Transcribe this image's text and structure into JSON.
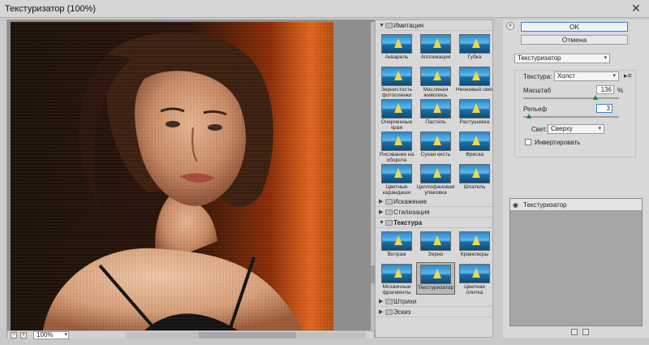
{
  "window": {
    "title": "Текстуризатор (100%)"
  },
  "preview": {
    "zoom": "100%",
    "zoom_out": "−",
    "zoom_in": "+"
  },
  "gallery": {
    "groups": [
      {
        "name": "Имитация",
        "expanded": true,
        "bold": false,
        "items": [
          "Акварель",
          "Аппликация",
          "Губка",
          "Зернистость фотопленки",
          "Масляная живопись",
          "Неоновый свет",
          "Очерченные края",
          "Пастель",
          "Растушевка",
          "Рисование на обороте",
          "Сухая кисть",
          "Фреска",
          "Цветные карандаши",
          "Целлофановая упаковка",
          "Шпатель"
        ]
      },
      {
        "name": "Искажение",
        "expanded": false
      },
      {
        "name": "Стилизация",
        "expanded": false
      },
      {
        "name": "Текстура",
        "expanded": true,
        "bold": true,
        "items": [
          "Витраж",
          "Зерно",
          "Кракелюры",
          "Мозаичные фрагменты",
          "Текстуризатор",
          "Цветная плитка"
        ],
        "selected": "Текстуризатор"
      },
      {
        "name": "Штрихи",
        "expanded": false
      },
      {
        "name": "Эскиз",
        "expanded": false
      }
    ]
  },
  "panel": {
    "ok_label": "OK",
    "cancel_label": "Отмена",
    "filter_select": "Текстуризатор",
    "texture_label": "Текстура:",
    "texture_value": "Холст",
    "scale_label": "Масштаб",
    "scale_value": "136",
    "scale_unit": "%",
    "scale_level": 0.75,
    "relief_label": "Рельеф",
    "relief_value": "3",
    "relief_level": 0.06,
    "light_label": "Свет:",
    "light_value": "Сверху",
    "invert_label": "Инвертировать",
    "invert_checked": false,
    "layer_name": "Текстуризатор"
  },
  "colors": {
    "accent": "#3c7fd1",
    "slider_thumb": "#2e7d43"
  }
}
